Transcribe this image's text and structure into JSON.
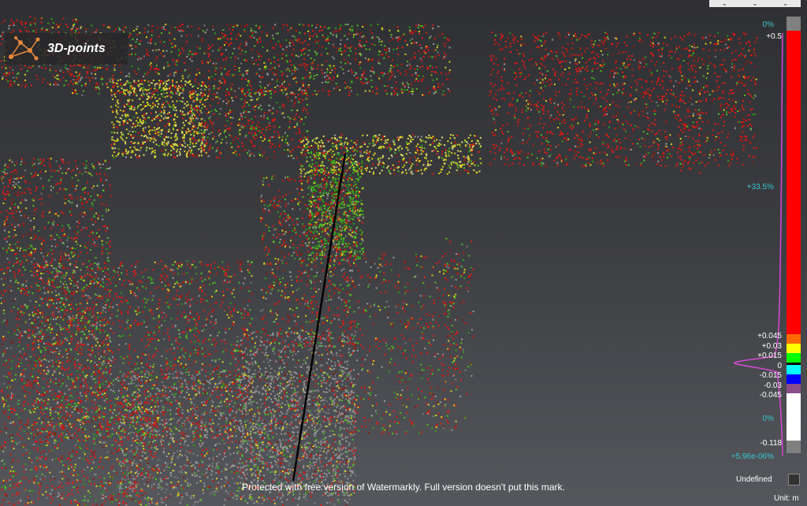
{
  "logo": {
    "text": "3D-points",
    "icon": "network-nodes-icon"
  },
  "toolbar": {
    "icons": [
      "view-dropdown-icon",
      "zoom-dropdown-icon",
      "pan-dropdown-icon"
    ],
    "glyphs": [
      "⌄",
      "⌄",
      "⌄"
    ]
  },
  "legend": {
    "top_pct": "0%",
    "max": "+0.5",
    "mid_pct": "+33.5%",
    "ticks": [
      "+0.045",
      "+0.03",
      "+0.015",
      "0",
      "-0.015",
      "-0.03",
      "-0.045"
    ],
    "low_pct": "0%",
    "min": "-0.118",
    "bottom_pct": "+5.96e-06%",
    "undefined_label": "Undefined",
    "unit": "Unit: m",
    "colors": {
      "top_cap": "#808080",
      "max_band": "#ff0000",
      "band_045": "#ff6a00",
      "band_030": "#ffff00",
      "band_015": "#00ff00",
      "band_000": "#00ffff",
      "band_m015": "#0000ff",
      "band_m030": "#8a4f8a",
      "low_band": "#ffffff",
      "bottom_cap": "#808080",
      "histogram": "#d648d6"
    }
  },
  "watermark": "Protected with free version of Watermarkly. Full version doesn't put this mark."
}
